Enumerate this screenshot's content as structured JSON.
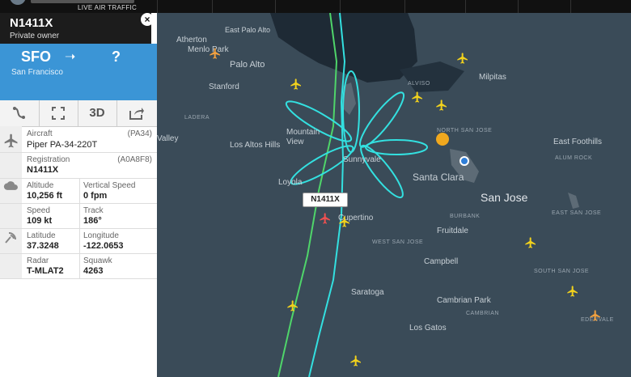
{
  "topbar": {
    "logo_sub": "LIVE AIR TRAFFIC"
  },
  "flight": {
    "callsign": "N1411X",
    "owner": "Private owner",
    "origin_code": "SFO",
    "origin_name": "San Francisco",
    "arrow": "➝",
    "dest_code": "?",
    "close": "×"
  },
  "toolbar": {
    "btn_3d": "3D"
  },
  "details": {
    "aircraft_label": "Aircraft",
    "aircraft_code": "(PA34)",
    "aircraft_value": "Piper PA-34-220T",
    "registration_label": "Registration",
    "registration_code": "(A0A8F8)",
    "registration_value": "N1411X",
    "altitude_label": "Altitude",
    "altitude_value": "10,256 ft",
    "vspeed_label": "Vertical Speed",
    "vspeed_value": "0 fpm",
    "speed_label": "Speed",
    "speed_value": "109 kt",
    "track_label": "Track",
    "track_value": "186°",
    "lat_label": "Latitude",
    "lat_value": "37.3248",
    "lon_label": "Longitude",
    "lon_value": "-122.0653",
    "radar_label": "Radar",
    "radar_value": "T-MLAT2",
    "squawk_label": "Squawk",
    "squawk_value": "4263"
  },
  "map": {
    "flight_tag": "N1411X",
    "cities": {
      "atherton": "Atherton",
      "menlo_park": "Menlo Park",
      "east_palo_alto": "East Palo Alto",
      "palo_alto": "Palo Alto",
      "stanford": "Stanford",
      "milpitas": "Milpitas",
      "ladera": "LADERA",
      "valley": "Valley",
      "los_altos_hills": "Los Altos Hills",
      "mountain_view": "Mountain View",
      "sunnyvale": "Sunnyvale",
      "north_san_jose": "NORTH SAN JOSE",
      "east_foothills": "East Foothills",
      "alum_rock": "ALUM ROCK",
      "santa_clara": "Santa Clara",
      "loyola": "Loyola",
      "san_jose": "San Jose",
      "cupertino": "Cupertino",
      "burbank": "BURBANK",
      "east_san_jose": "EAST SAN JOSE",
      "fruitdale": "Fruitdale",
      "west_san_jose": "WEST SAN JOSE",
      "campbell": "Campbell",
      "south_san_jose": "SOUTH SAN JOSE",
      "saratoga": "Saratoga",
      "cambrian_park": "Cambrian Park",
      "cambrian": "CAMBRIAN",
      "los_gatos": "Los Gatos",
      "edenvale": "EDENVALE",
      "alviso": "ALVISO"
    }
  },
  "colors": {
    "route_blue": "#3b95d6",
    "track_cyan": "#33e0e0",
    "track_green": "#4fd56a",
    "plane_yellow": "#f2d21c",
    "selected_plane": "#f05050"
  },
  "icons": {
    "share": "share-icon",
    "route": "route-icon",
    "fullscreen": "fullscreen-icon",
    "plane": "plane-icon",
    "cloud": "cloud-icon",
    "radar": "radar-icon"
  }
}
